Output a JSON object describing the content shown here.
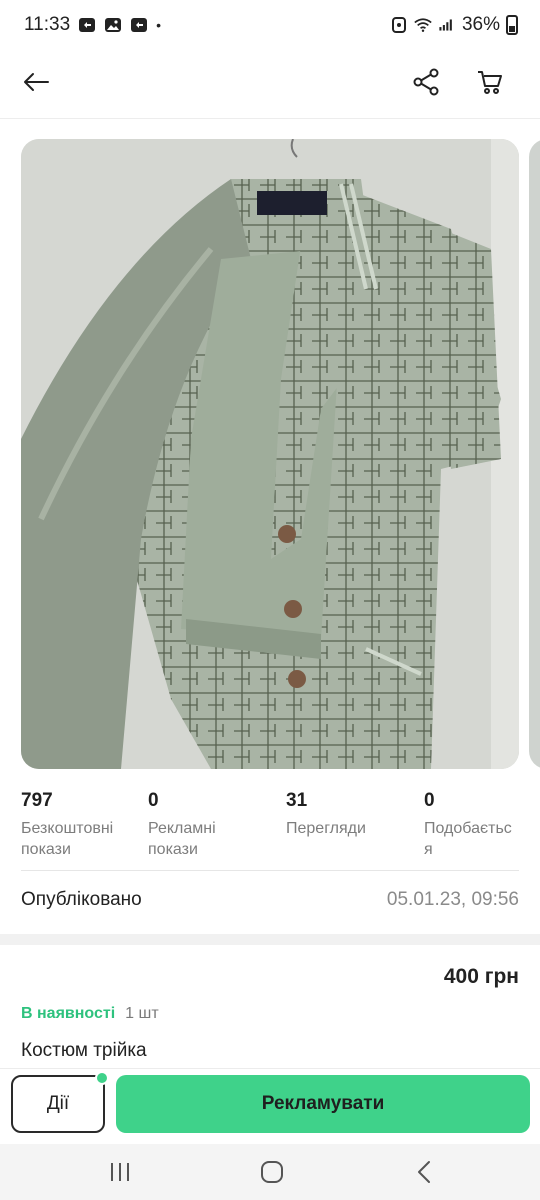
{
  "status_bar": {
    "time": "11:33",
    "dot": "•",
    "battery": "36%",
    "icons_left": [
      "recording-icon",
      "gallery-icon",
      "recording-icon"
    ],
    "icons_right": [
      "wifi-icon",
      "signal-icon",
      "battery-icon"
    ]
  },
  "app_bar": {
    "icons": [
      "back-arrow-icon",
      "share-icon",
      "cart-icon"
    ]
  },
  "listing": {
    "photo_alt": "Костюм трійка",
    "stats": [
      {
        "value": "797",
        "label": "Безкоштовні покази"
      },
      {
        "value": "0",
        "label": "Рекламні покази"
      },
      {
        "value": "31",
        "label": "Перегляди"
      },
      {
        "value": "0",
        "label": "Подобається"
      }
    ],
    "published_label": "Опубліковано",
    "published_date": "05.01.23, 09:56",
    "price": "400 грн",
    "availability": "В наявності",
    "quantity": "1 шт",
    "title": "Костюм трійка"
  },
  "actions": {
    "actions_label": "Дії",
    "promote_label": "Рекламувати"
  },
  "colors": {
    "accent": "#3fd28a",
    "availability": "#2ec27e",
    "secondary_text": "#7d7d7d"
  },
  "nav_bar": {
    "icons": [
      "recents-icon",
      "home-icon",
      "back-icon"
    ]
  }
}
